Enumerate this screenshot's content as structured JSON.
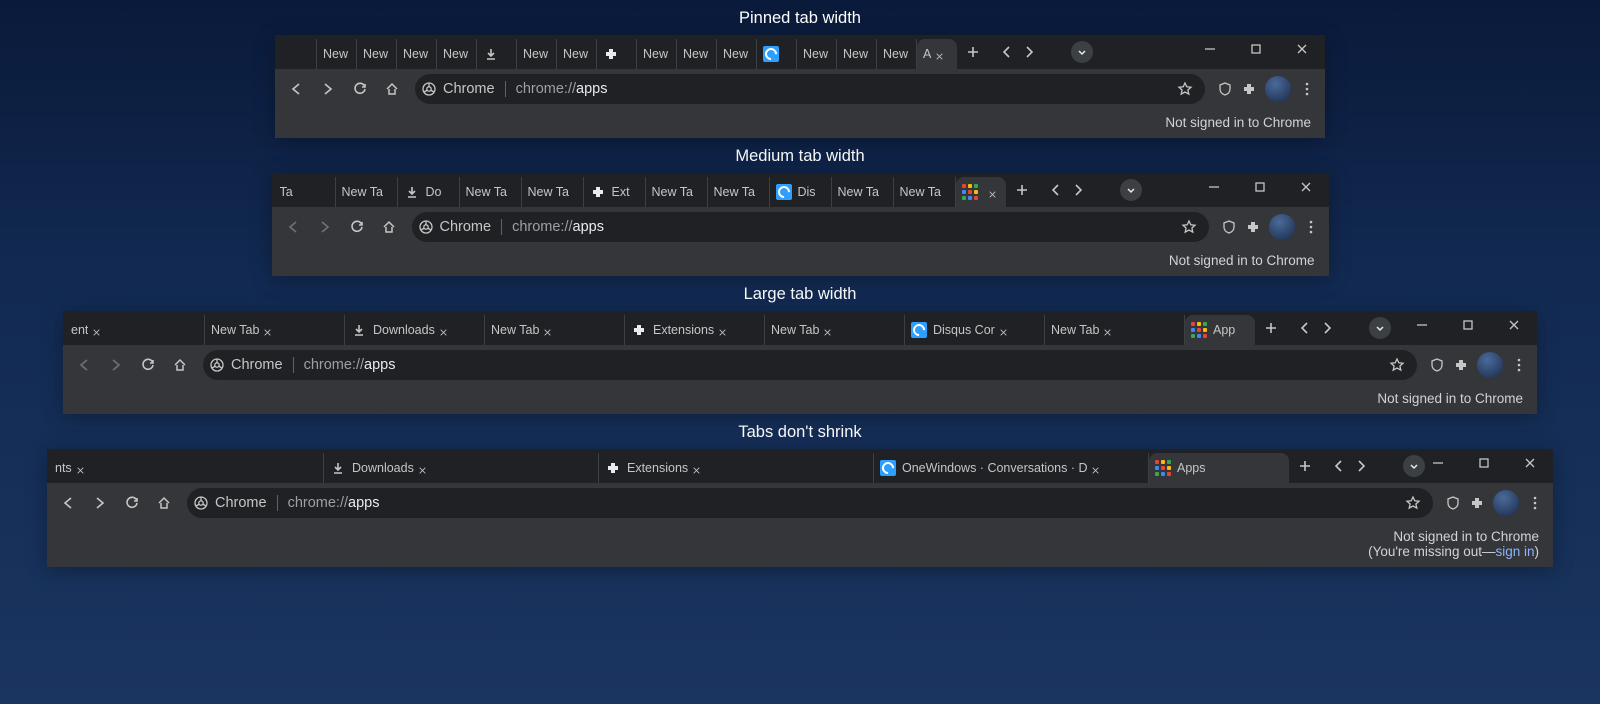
{
  "captions": {
    "pinned": "Pinned tab width",
    "medium": "Medium tab width",
    "large": "Large tab width",
    "noshrink": "Tabs don't shrink"
  },
  "omni": {
    "chip": "Chrome",
    "url_dark": "chrome://",
    "url_light": "apps"
  },
  "infobar": {
    "not_signed": "Not signed in to Chrome",
    "missing_a": "(You're missing out—",
    "signin": "sign in",
    "missing_b": ")"
  },
  "windows": {
    "w1_tabs": [
      {
        "label": "",
        "icon": "none",
        "show_x": false
      },
      {
        "label": "New",
        "icon": "none",
        "show_x": false
      },
      {
        "label": "New",
        "icon": "none",
        "show_x": false
      },
      {
        "label": "New",
        "icon": "none",
        "show_x": false
      },
      {
        "label": "New",
        "icon": "none",
        "show_x": false
      },
      {
        "label": "",
        "icon": "download",
        "show_x": false
      },
      {
        "label": "New",
        "icon": "none",
        "show_x": false
      },
      {
        "label": "New",
        "icon": "none",
        "show_x": false
      },
      {
        "label": "",
        "icon": "puzzle",
        "show_x": false
      },
      {
        "label": "New",
        "icon": "none",
        "show_x": false
      },
      {
        "label": "New",
        "icon": "none",
        "show_x": false
      },
      {
        "label": "New",
        "icon": "none",
        "show_x": false
      },
      {
        "label": "",
        "icon": "disqus",
        "show_x": false
      },
      {
        "label": "New",
        "icon": "none",
        "show_x": false
      },
      {
        "label": "New",
        "icon": "none",
        "show_x": false
      },
      {
        "label": "New",
        "icon": "none",
        "show_x": false
      },
      {
        "label": "A",
        "icon": "none",
        "show_x": true,
        "active": true
      }
    ],
    "w2_tabs": [
      {
        "label": "Ta",
        "icon": "none",
        "show_x": false
      },
      {
        "label": "New Ta",
        "icon": "none",
        "show_x": false
      },
      {
        "label": "Do",
        "icon": "download",
        "show_x": false
      },
      {
        "label": "New Ta",
        "icon": "none",
        "show_x": false
      },
      {
        "label": "New Ta",
        "icon": "none",
        "show_x": false
      },
      {
        "label": "Ext",
        "icon": "puzzle",
        "show_x": false
      },
      {
        "label": "New Ta",
        "icon": "none",
        "show_x": false
      },
      {
        "label": "New Ta",
        "icon": "none",
        "show_x": false
      },
      {
        "label": "Dis",
        "icon": "disqus",
        "show_x": false
      },
      {
        "label": "New Ta",
        "icon": "none",
        "show_x": false
      },
      {
        "label": "New Ta",
        "icon": "none",
        "show_x": false
      },
      {
        "label": "",
        "icon": "apps",
        "show_x": true,
        "active": true
      }
    ],
    "w3_tabs": [
      {
        "label": "ent",
        "icon": "none",
        "show_x": true
      },
      {
        "label": "New Tab",
        "icon": "none",
        "show_x": true
      },
      {
        "label": "Downloads",
        "icon": "download",
        "show_x": true
      },
      {
        "label": "New Tab",
        "icon": "none",
        "show_x": true
      },
      {
        "label": "Extensions",
        "icon": "puzzle",
        "show_x": true
      },
      {
        "label": "New Tab",
        "icon": "none",
        "show_x": true
      },
      {
        "label": "Disqus Cor",
        "icon": "disqus",
        "show_x": true
      },
      {
        "label": "New Tab",
        "icon": "none",
        "show_x": true
      },
      {
        "label": "App",
        "icon": "apps",
        "show_x": false,
        "active": true
      }
    ],
    "w4_tabs": [
      {
        "label": "nts",
        "icon": "none",
        "show_x": true
      },
      {
        "label": "Downloads",
        "icon": "download",
        "show_x": true
      },
      {
        "label": "Extensions",
        "icon": "puzzle",
        "show_x": true
      },
      {
        "label": "OneWindows · Conversations · D",
        "icon": "disqus",
        "show_x": true
      },
      {
        "label": "Apps",
        "icon": "apps",
        "show_x": false,
        "active": true
      }
    ]
  },
  "tab_widths": {
    "w1": 40,
    "w1_active": 40,
    "w2": 62,
    "w2_active": 50,
    "w3": 140,
    "w3_active": 70,
    "w4": 275,
    "w4_active": 140
  },
  "nav_disabled": {
    "w1": false,
    "w2": true,
    "w3": true,
    "w4": false
  }
}
